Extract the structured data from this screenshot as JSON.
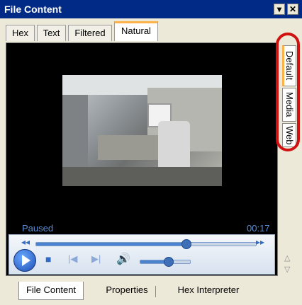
{
  "window": {
    "title": "File Content",
    "dropdown_icon": "chevron-down-icon",
    "close_icon": "close-icon"
  },
  "top_tabs": [
    {
      "label": "Hex"
    },
    {
      "label": "Text"
    },
    {
      "label": "Filtered"
    },
    {
      "label": "Natural",
      "active": true
    }
  ],
  "player": {
    "status": "Paused",
    "time": "00:17",
    "seek_progress": 0.68,
    "volume_level": 0.55
  },
  "side_tabs": [
    {
      "label": "Default",
      "active": true
    },
    {
      "label": "Media"
    },
    {
      "label": "Web"
    }
  ],
  "bottom_tabs": [
    {
      "label": "File Content",
      "active": true
    },
    {
      "label": "Properties"
    },
    {
      "label": "Hex Interpreter"
    }
  ],
  "colors": {
    "title_bar": "#002a85",
    "annotation_red": "#d11010",
    "player_blue": "#2f6cc6"
  }
}
